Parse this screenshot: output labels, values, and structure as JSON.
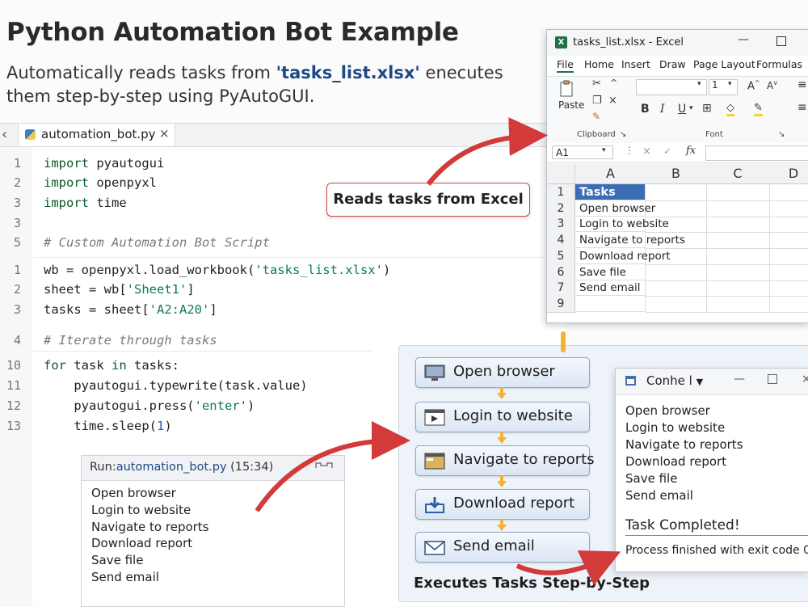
{
  "heading": {
    "title": "Python Automation Bot Example",
    "subtitle_pre": "Automatically reads tasks from ",
    "subtitle_file": "'tasks_list.xlsx'",
    "subtitle_post": " enecutes them step-by-step using PyAutoGUI."
  },
  "ide": {
    "tab_label": "automation_bot.py",
    "tab_close": "×",
    "back": "‹",
    "lines": [
      {
        "n": "1",
        "code": [
          {
            "t": "import",
            "c": "kw"
          },
          {
            "t": " pyautogui"
          }
        ]
      },
      {
        "n": "2",
        "code": [
          {
            "t": "import",
            "c": "kw"
          },
          {
            "t": " openpyxl"
          }
        ]
      },
      {
        "n": "3",
        "code": [
          {
            "t": "import",
            "c": "kw"
          },
          {
            "t": " time"
          }
        ]
      },
      {
        "n": "3",
        "code": []
      },
      {
        "n": "5",
        "code": [
          {
            "t": "# Custom Automation Bot Script",
            "c": "cmt"
          }
        ]
      },
      {
        "n": "1",
        "code": [
          {
            "t": "wb = openpyxl.load_workbook("
          },
          {
            "t": "'tasks_list.xlsx'",
            "c": "str"
          },
          {
            "t": ")"
          }
        ]
      },
      {
        "n": "2",
        "code": [
          {
            "t": "sheet = wb["
          },
          {
            "t": "'Sheet1'",
            "c": "str"
          },
          {
            "t": "]"
          }
        ]
      },
      {
        "n": "3",
        "code": [
          {
            "t": "tasks = sheet["
          },
          {
            "t": "'A2:A20'",
            "c": "str"
          },
          {
            "t": "]"
          }
        ]
      },
      {
        "n": "4",
        "code": [
          {
            "t": "# Iterate through tasks",
            "c": "cmt"
          }
        ]
      },
      {
        "n": "10",
        "code": [
          {
            "t": "for",
            "c": "kw"
          },
          {
            "t": " task "
          },
          {
            "t": "in",
            "c": "kw"
          },
          {
            "t": " tasks:"
          }
        ]
      },
      {
        "n": "11",
        "code": [
          {
            "t": "    pyautogui.typewrite(task.value)"
          }
        ]
      },
      {
        "n": "12",
        "code": [
          {
            "t": "    pyautogui.press("
          },
          {
            "t": "'enter'",
            "c": "str"
          },
          {
            "t": ")"
          }
        ]
      },
      {
        "n": "13",
        "code": [
          {
            "t": "    time.sleep("
          },
          {
            "t": "1",
            "c": "num"
          },
          {
            "t": ")"
          }
        ]
      }
    ]
  },
  "run_panel": {
    "prefix": "Run:",
    "file": "automation_bot.py",
    "time": "(15:34)",
    "output": [
      "Open browser",
      "Login to website",
      "Navigate to reports",
      "Download report",
      "Save file",
      "Send email"
    ]
  },
  "excel": {
    "title": "tasks_list.xlsx - Excel",
    "menu": [
      "File",
      "Home",
      "Insert",
      "Draw",
      "Page Layout",
      "Formulas"
    ],
    "paste_label": "Paste",
    "clipboard_label": "Clipboard",
    "font_label": "Font",
    "font_size": "1",
    "name_box": "A1",
    "fx": "fx",
    "columns": [
      "A",
      "B",
      "C",
      "D"
    ],
    "rows": [
      {
        "n": "1",
        "a": "Tasks"
      },
      {
        "n": "2",
        "a": "Open browser"
      },
      {
        "n": "3",
        "a": "Login to website"
      },
      {
        "n": "4",
        "a": "Navigate to reports"
      },
      {
        "n": "5",
        "a": "Download report"
      },
      {
        "n": "6",
        "a": "Save file"
      },
      {
        "n": "7",
        "a": "Send email"
      },
      {
        "n": "9",
        "a": ""
      }
    ]
  },
  "callout": "Reads tasks from Excel",
  "flow": {
    "steps": [
      {
        "label": "Open browser",
        "icon": "monitor-icon"
      },
      {
        "label": "Login to website",
        "icon": "login-window-icon"
      },
      {
        "label": "Navigate to reports",
        "icon": "folder-window-icon"
      },
      {
        "label": "Download report",
        "icon": "download-icon"
      },
      {
        "label": "Send email",
        "icon": "envelope-icon"
      }
    ],
    "caption": "Executes Tasks Step-by-Step"
  },
  "console": {
    "title": "Conhe l",
    "lines": [
      "Open browser",
      "Login to website",
      "Navigate to reports",
      "Download report",
      "Save file",
      "Send email"
    ],
    "done": "Task Completed!",
    "exit": "Process finished with exit code 0"
  },
  "colors": {
    "accent_red": "#d33a3a",
    "excel_green": "#1d7345",
    "header_blue": "#3a6db3",
    "flow_arrow": "#f2b233"
  }
}
